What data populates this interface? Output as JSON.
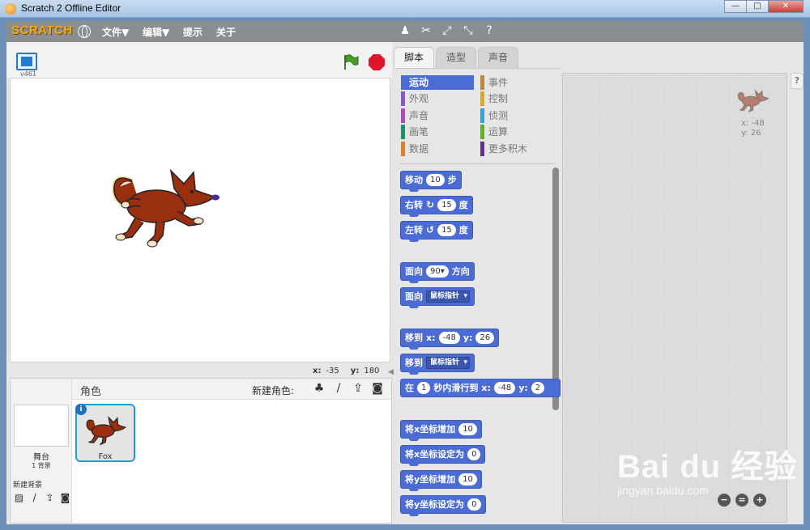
{
  "window": {
    "title": "Scratch 2 Offline Editor",
    "minimize": "—",
    "maximize": "□",
    "close": "✕"
  },
  "menubar": {
    "logo": "SCRATCH",
    "items": [
      "文件▼",
      "编辑▼",
      "提示",
      "关于"
    ],
    "tool_icons": [
      "duplicate-icon",
      "cut-icon",
      "grow-icon",
      "shrink-icon",
      "help-icon"
    ]
  },
  "stage": {
    "version": "v461",
    "coords": {
      "x_label": "x:",
      "x_value": "-35",
      "y_label": "y:",
      "y_value": "180"
    }
  },
  "sprites": {
    "title": "角色",
    "new_sprite_label": "新建角色:",
    "stage_label": "舞台",
    "backdrop_count": "1 背景",
    "new_backdrop_label": "新建背景",
    "sprite_name": "Fox"
  },
  "tabs": [
    "脚本",
    "造型",
    "声音"
  ],
  "categories": [
    {
      "label": "运动",
      "color": "#4a6cd4",
      "active": true
    },
    {
      "label": "事件",
      "color": "#c88330"
    },
    {
      "label": "外观",
      "color": "#8a55d7"
    },
    {
      "label": "控制",
      "color": "#e1a91a"
    },
    {
      "label": "声音",
      "color": "#bb42c3"
    },
    {
      "label": "侦测",
      "color": "#2ca5e2"
    },
    {
      "label": "画笔",
      "color": "#0e9a6c"
    },
    {
      "label": "运算",
      "color": "#5cb712"
    },
    {
      "label": "数据",
      "color": "#ee7d16"
    },
    {
      "label": "更多积木",
      "color": "#632d99"
    }
  ],
  "blocks": {
    "move": {
      "label": "移动",
      "value": "10",
      "unit": "步"
    },
    "turn_right": {
      "label": "右转",
      "value": "15",
      "unit": "度"
    },
    "turn_left": {
      "label": "左转",
      "value": "15",
      "unit": "度"
    },
    "point_dir": {
      "label": "面向",
      "value": "90▾",
      "unit": "方向"
    },
    "point_towards": {
      "label": "面向",
      "option": "鼠标指针"
    },
    "goto_xy": {
      "label": "移到",
      "x_label": "x:",
      "x_value": "-48",
      "y_label": "y:",
      "y_value": "26"
    },
    "goto": {
      "label": "移到",
      "option": "鼠标指针"
    },
    "glide": {
      "label": "在",
      "secs": "1",
      "middle": "秒内滑行到",
      "x_label": "x:",
      "x_value": "-48",
      "y_label": "y:",
      "y_value": "2"
    },
    "change_x": {
      "label": "将x坐标增加",
      "value": "10"
    },
    "set_x": {
      "label": "将x坐标设定为",
      "value": "0"
    },
    "change_y": {
      "label": "将y坐标增加",
      "value": "10"
    },
    "set_y": {
      "label": "将y坐标设定为",
      "value": "0"
    }
  },
  "scripts_area": {
    "x_text": "x: -48",
    "y_text": "y: 26",
    "help": "?"
  },
  "zoom": {
    "out": "−",
    "reset": "=",
    "in": "+"
  },
  "watermark": {
    "main": "Bai du 经验",
    "sub": "jingyan.baidu.com"
  }
}
